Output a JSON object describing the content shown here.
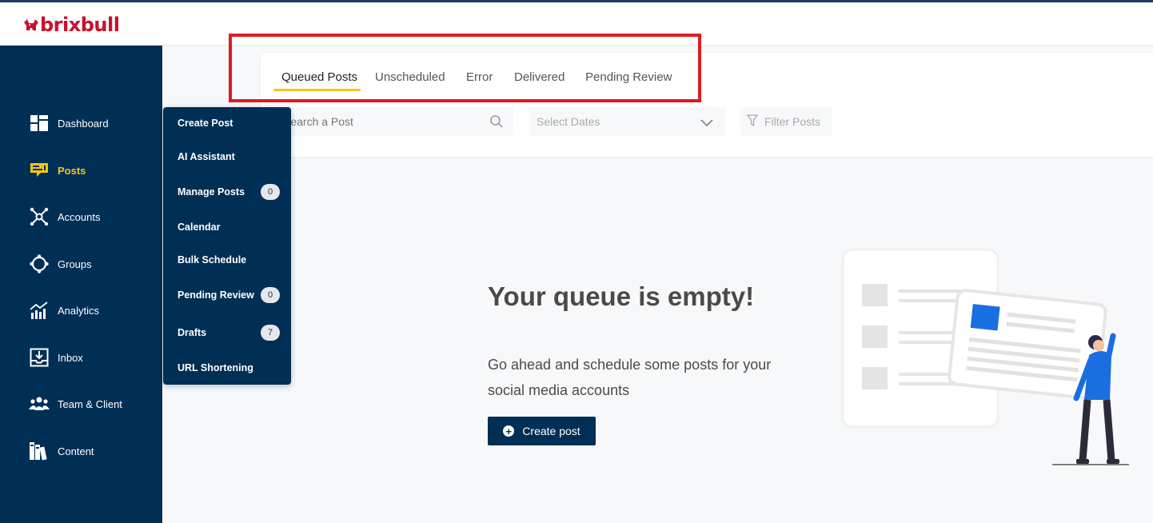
{
  "brand": {
    "name": "brixbull"
  },
  "sidebar": {
    "items": [
      {
        "label": "Dashboard",
        "icon": "dashboard-icon"
      },
      {
        "label": "Posts",
        "icon": "posts-icon",
        "active": true
      },
      {
        "label": "Accounts",
        "icon": "accounts-icon"
      },
      {
        "label": "Groups",
        "icon": "groups-icon"
      },
      {
        "label": "Analytics",
        "icon": "analytics-icon"
      },
      {
        "label": "Inbox",
        "icon": "inbox-icon"
      },
      {
        "label": "Team & Client",
        "icon": "team-icon"
      },
      {
        "label": "Content",
        "icon": "content-icon"
      }
    ]
  },
  "posts_menu": {
    "items": [
      {
        "label": "Create Post"
      },
      {
        "label": "AI Assistant"
      },
      {
        "label": "Manage Posts",
        "badge": "0"
      },
      {
        "label": "Calendar"
      },
      {
        "label": "Bulk Schedule"
      },
      {
        "label": "Pending Review",
        "badge": "0"
      },
      {
        "label": "Drafts",
        "badge": "7"
      },
      {
        "label": "URL Shortening"
      }
    ]
  },
  "tabs": [
    {
      "label": "Queued Posts",
      "active": true
    },
    {
      "label": "Unscheduled"
    },
    {
      "label": "Error"
    },
    {
      "label": "Delivered"
    },
    {
      "label": "Pending Review"
    }
  ],
  "filters": {
    "search_placeholder": "Search a Post",
    "dates_placeholder": "Select Dates",
    "filter_label": "Filter Posts"
  },
  "empty_state": {
    "title": "Your queue is empty!",
    "description": "Go ahead and schedule some posts for your social media accounts",
    "button_label": "Create post"
  },
  "colors": {
    "sidebar_bg": "#002f55",
    "accent_yellow": "#f5c518",
    "brand_red": "#c8102e",
    "highlight_red": "#e01b24"
  }
}
